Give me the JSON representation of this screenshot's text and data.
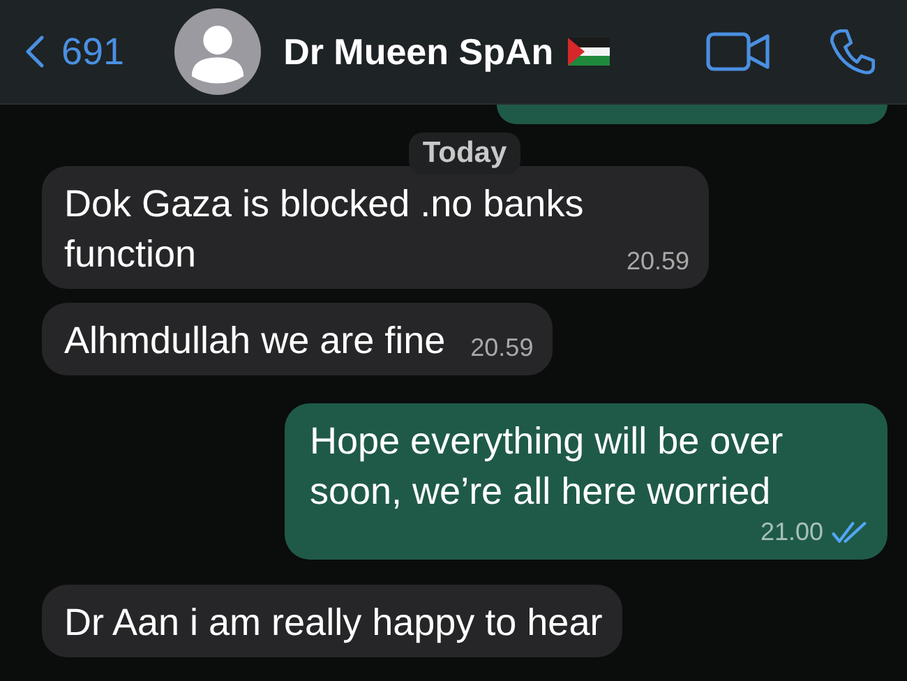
{
  "header": {
    "back_count": "691",
    "contact_name": "Dr Mueen SpAn"
  },
  "date_chip": "Today",
  "messages": [
    {
      "kind": "cut"
    },
    {
      "kind": "incoming",
      "text": "Dok Gaza is blocked .no banks function",
      "time": "20.59"
    },
    {
      "kind": "incoming",
      "text": "Alhmdullah we are fine",
      "time": "20.59"
    },
    {
      "kind": "outgoing",
      "text": "Hope everything will be over soon, we’re all here worried",
      "time": "21.00",
      "read": true
    },
    {
      "kind": "incoming",
      "text": "Dr Aan i am really happy to hear"
    }
  ]
}
